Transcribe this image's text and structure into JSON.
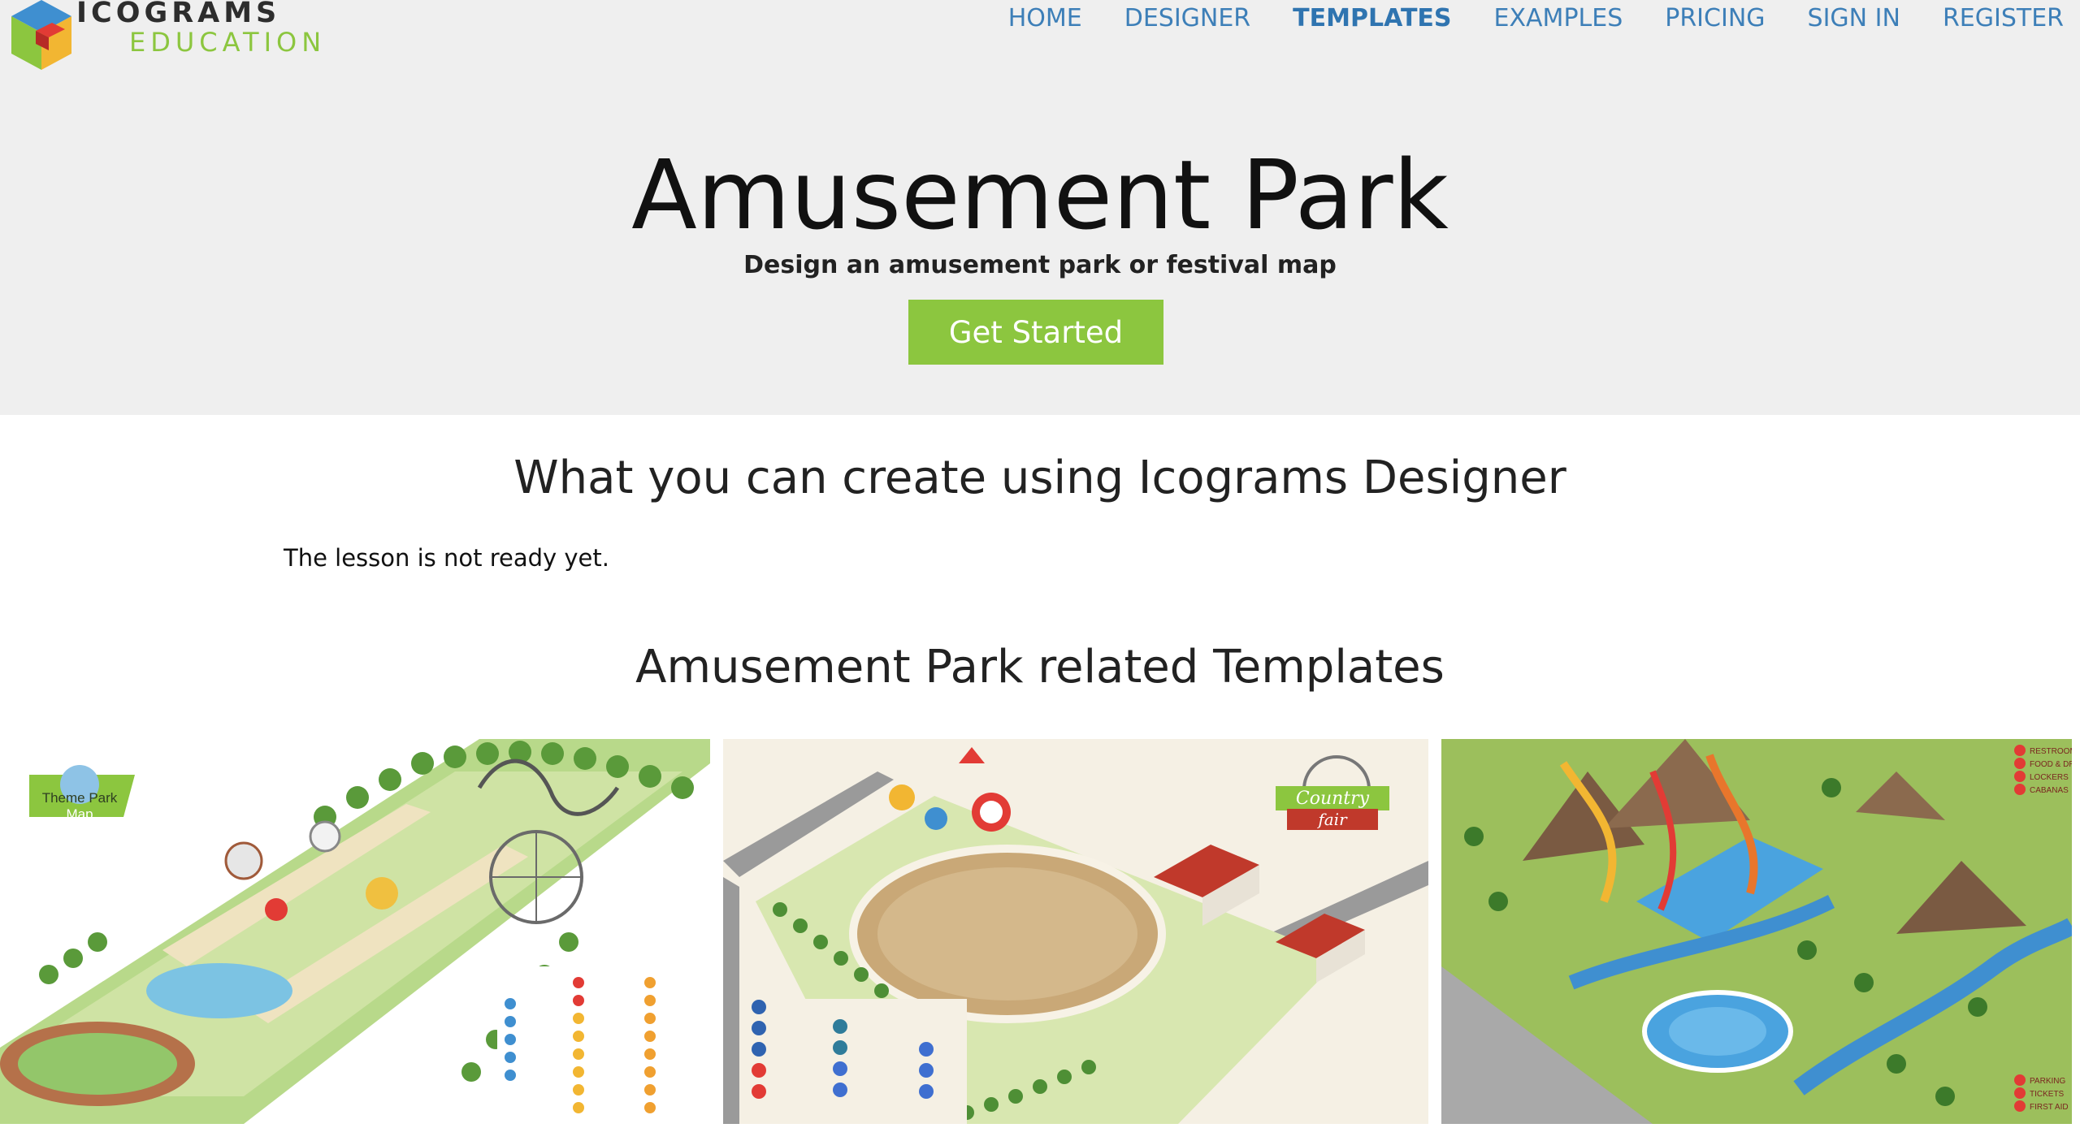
{
  "brand": {
    "line1": "ICOGRAMS",
    "line2": "EDUCATION"
  },
  "nav": {
    "items": [
      {
        "label": "HOME",
        "active": false
      },
      {
        "label": "DESIGNER",
        "active": false
      },
      {
        "label": "TEMPLATES",
        "active": true
      },
      {
        "label": "EXAMPLES",
        "active": false
      },
      {
        "label": "PRICING",
        "active": false
      },
      {
        "label": "SIGN IN",
        "active": false
      },
      {
        "label": "REGISTER",
        "active": false
      }
    ]
  },
  "hero": {
    "title": "Amusement Park",
    "subtitle": "Design an amusement park or festival map",
    "cta_label": "Get Started"
  },
  "create_section": {
    "heading": "What you can create using Icograms Designer",
    "message": "The lesson is not ready yet."
  },
  "templates_section": {
    "heading": "Amusement Park related Templates",
    "cards": [
      {
        "badge_line1": "Theme Park",
        "badge_line2": "Map"
      },
      {
        "badge_line1": "Country",
        "badge_line2": "fair"
      },
      {
        "legend": [
          "RESTROOMS",
          "FOOD & DRINKS",
          "LOCKERS",
          "CABANAS"
        ],
        "legend_bottom": [
          "PARKING",
          "TICKETS",
          "FIRST AID"
        ]
      }
    ]
  },
  "colors": {
    "hero_bg": "#efefef",
    "nav_link": "#3d7fb8",
    "brand_green": "#8cc63f",
    "cta_bg": "#8cc63f"
  }
}
